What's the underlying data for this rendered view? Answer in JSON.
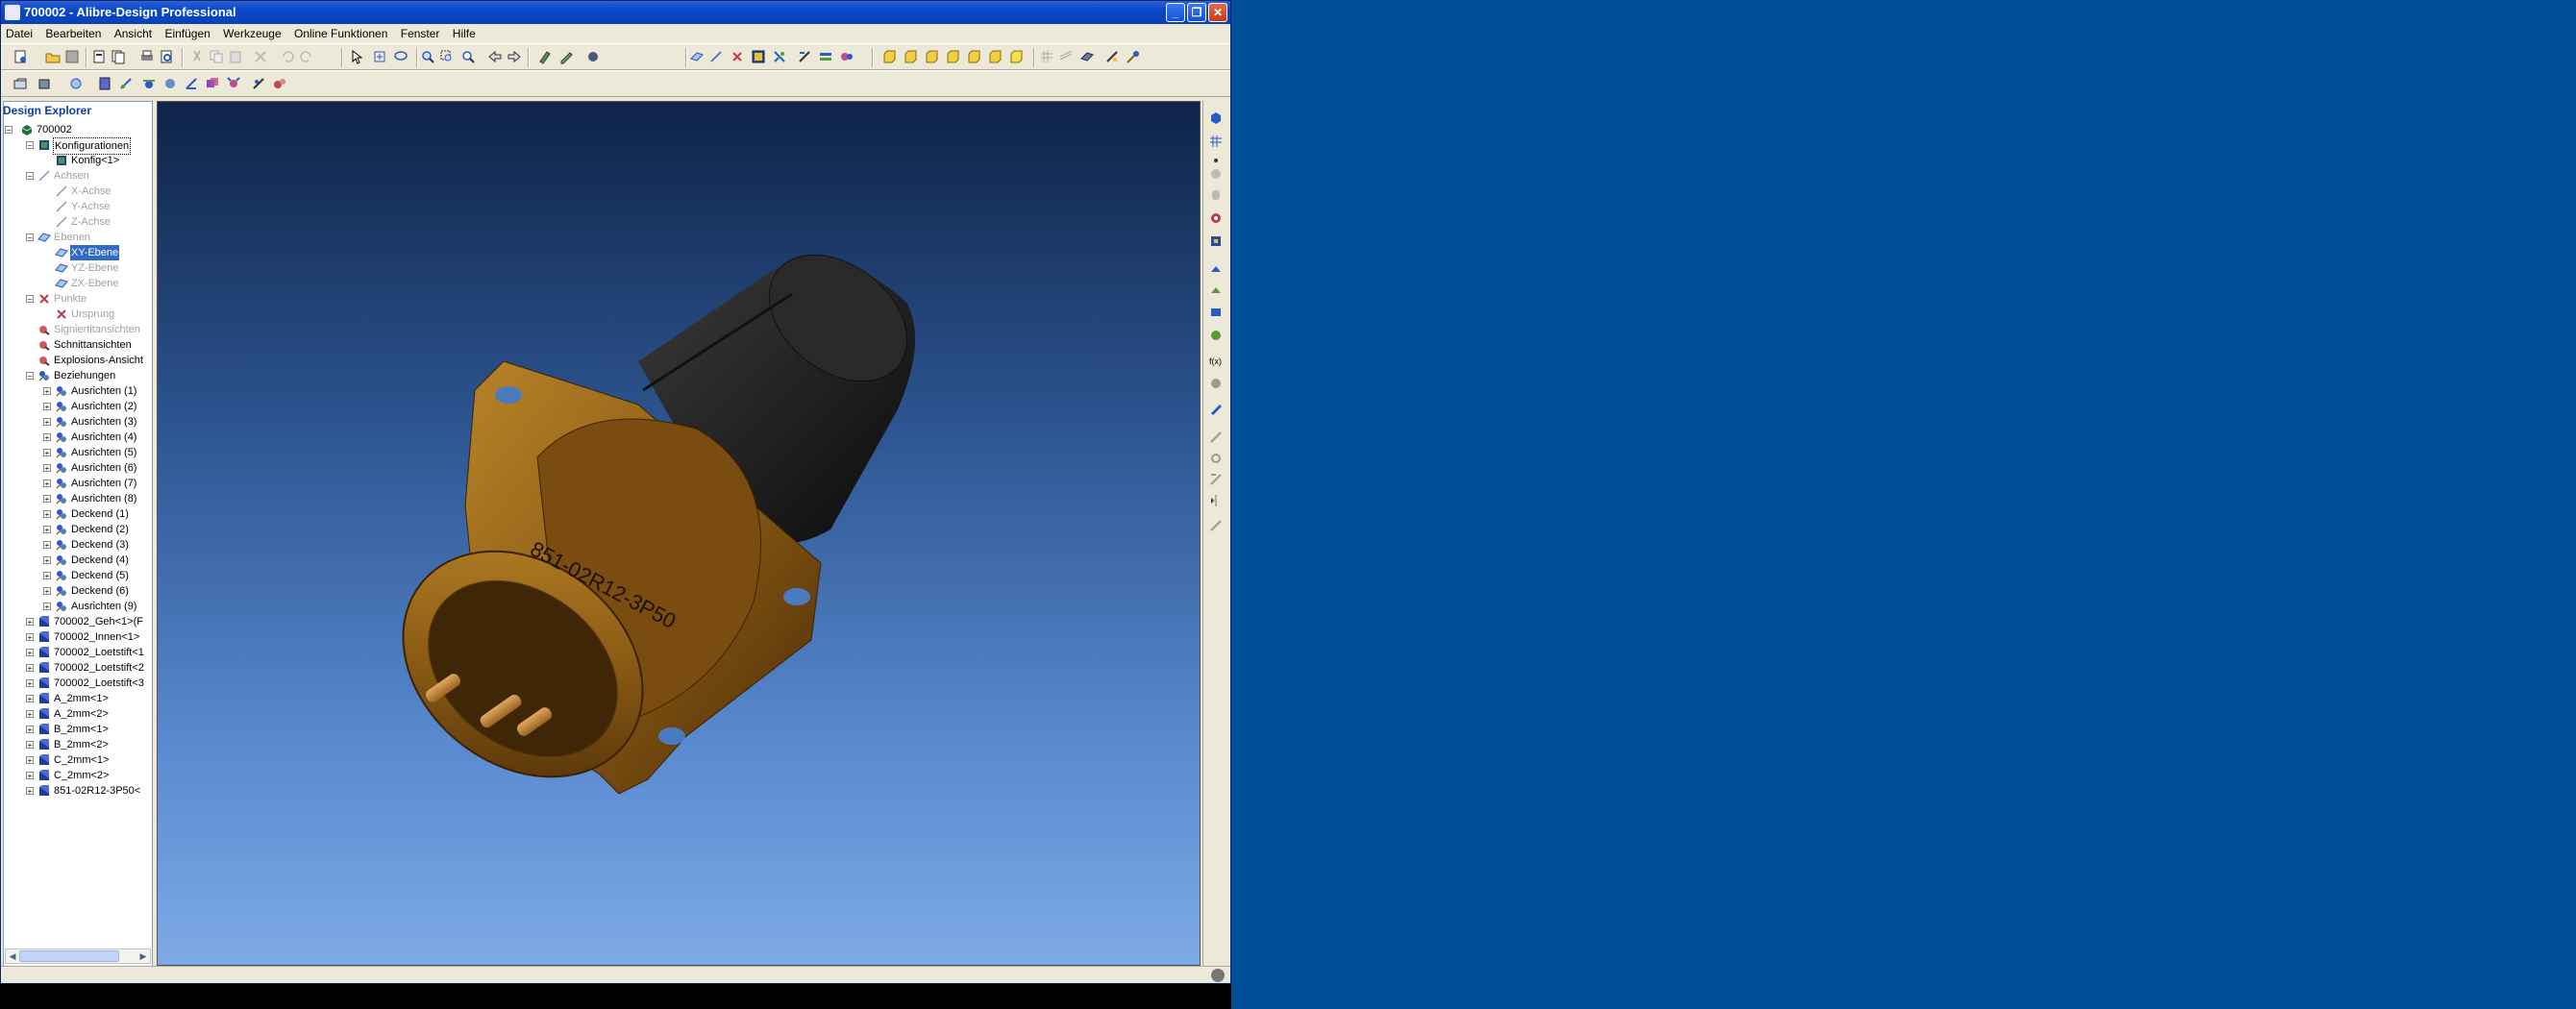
{
  "window": {
    "title": "700002 - Alibre-Design Professional"
  },
  "menu": [
    "Datei",
    "Bearbeiten",
    "Ansicht",
    "Einfügen",
    "Werkzeuge",
    "Online Funktionen",
    "Fenster",
    "Hilfe"
  ],
  "explorer": {
    "title": "Design Explorer",
    "nodes": [
      "700002",
      "Konfigurationen",
      "Konfig<1>",
      "Achsen",
      "X-Achse",
      "Y-Achse",
      "Z-Achse",
      "Ebenen",
      "XY-Ebene",
      "YZ-Ebene",
      "ZX-Ebene",
      "Punkte",
      "Ursprung",
      "Signiertitansichten",
      "Schnittansichten",
      "Explosions-Ansicht",
      "Beziehungen",
      "Ausrichten (1)",
      "Ausrichten (2)",
      "Ausrichten (3)",
      "Ausrichten (4)",
      "Ausrichten (5)",
      "Ausrichten (6)",
      "Ausrichten (7)",
      "Ausrichten (8)",
      "Deckend (1)",
      "Deckend (2)",
      "Deckend (3)",
      "Deckend (4)",
      "Deckend (5)",
      "Deckend (6)",
      "Ausrichten (9)",
      "700002_Geh<1>(F",
      "700002_Innen<1>",
      "700002_Loetstift<1",
      "700002_Loetstift<2",
      "700002_Loetstift<3",
      "A_2mm<1>",
      "A_2mm<2>",
      "B_2mm<1>",
      "B_2mm<2>",
      "C_2mm<1>",
      "C_2mm<2>",
      "851-02R12-3P50<"
    ]
  },
  "model": {
    "part_label": "851-02R12-3P50"
  },
  "colors": {
    "title_blue": "#0a48c8",
    "desktop": "#004e98",
    "selection": "#316ac5",
    "brass": "#8a5a14"
  }
}
